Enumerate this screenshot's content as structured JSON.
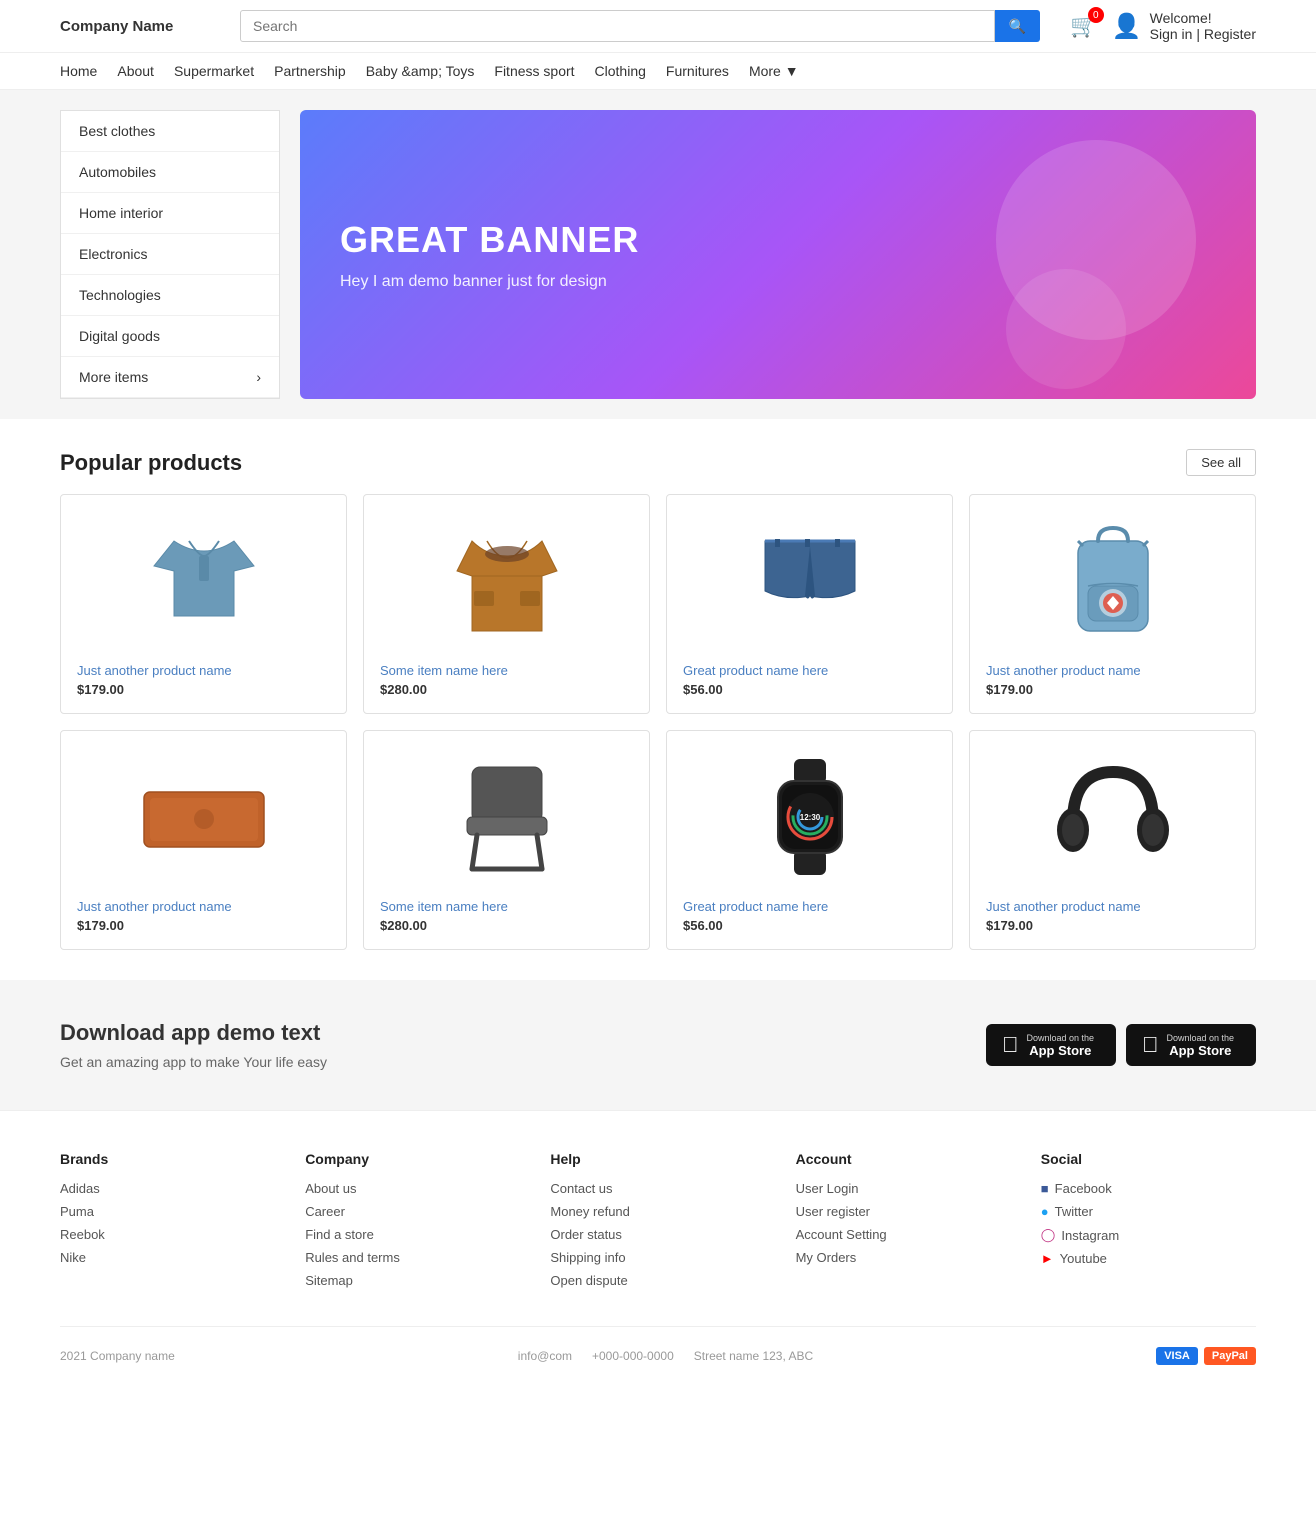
{
  "header": {
    "logo": "Company Name",
    "search_placeholder": "Search",
    "search_button_icon": "search-icon",
    "cart_count": "0",
    "welcome_text": "Welcome!",
    "signin_text": "Sign in | Register"
  },
  "nav": {
    "items": [
      {
        "label": "Home",
        "href": "#"
      },
      {
        "label": "About",
        "href": "#"
      },
      {
        "label": "Supermarket",
        "href": "#"
      },
      {
        "label": "Partnership",
        "href": "#"
      },
      {
        "label": "Baby &amp; Toys",
        "href": "#"
      },
      {
        "label": "Fitness sport",
        "href": "#"
      },
      {
        "label": "Clothing",
        "href": "#"
      },
      {
        "label": "Furnitures",
        "href": "#"
      },
      {
        "label": "More",
        "href": "#"
      }
    ]
  },
  "sidebar": {
    "categories": [
      {
        "label": "Best clothes"
      },
      {
        "label": "Automobiles"
      },
      {
        "label": "Home interior"
      },
      {
        "label": "Electronics"
      },
      {
        "label": "Technologies"
      },
      {
        "label": "Digital goods"
      },
      {
        "label": "More items",
        "has_arrow": true
      }
    ]
  },
  "banner": {
    "title": "GREAT BANNER",
    "subtitle": "Hey I am demo banner just for design"
  },
  "popular": {
    "title": "Popular products",
    "see_all": "See all",
    "products": [
      {
        "name": "Just another product name",
        "price": "$179.00",
        "type": "polo"
      },
      {
        "name": "Some item name here",
        "price": "$280.00",
        "type": "jacket"
      },
      {
        "name": "Great product name here",
        "price": "$56.00",
        "type": "shorts"
      },
      {
        "name": "Just another product name",
        "price": "$179.00",
        "type": "backpack"
      },
      {
        "name": "Just another product name",
        "price": "$179.00",
        "type": "laptop"
      },
      {
        "name": "Some item name here",
        "price": "$280.00",
        "type": "chair"
      },
      {
        "name": "Great product name here",
        "price": "$56.00",
        "type": "watch"
      },
      {
        "name": "Just another product name",
        "price": "$179.00",
        "type": "headphones"
      }
    ]
  },
  "download": {
    "title": "Download app demo text",
    "subtitle": "Get an amazing app to make Your life easy",
    "btn1_sub": "Download on the",
    "btn1_main": "App Store",
    "btn2_sub": "Download on the",
    "btn2_main": "App Store"
  },
  "footer": {
    "brands": {
      "title": "Brands",
      "links": [
        "Adidas",
        "Puma",
        "Reebok",
        "Nike"
      ]
    },
    "company": {
      "title": "Company",
      "links": [
        "About us",
        "Career",
        "Find a store",
        "Rules and terms",
        "Sitemap"
      ]
    },
    "help": {
      "title": "Help",
      "links": [
        "Contact us",
        "Money refund",
        "Order status",
        "Shipping info",
        "Open dispute"
      ]
    },
    "account": {
      "title": "Account",
      "links": [
        "User Login",
        "User register",
        "Account Setting",
        "My Orders"
      ]
    },
    "social": {
      "title": "Social",
      "links": [
        {
          "label": "Facebook",
          "icon": "facebook-icon"
        },
        {
          "label": "Twitter",
          "icon": "twitter-icon"
        },
        {
          "label": "Instagram",
          "icon": "instagram-icon"
        },
        {
          "label": "Youtube",
          "icon": "youtube-icon"
        }
      ]
    },
    "bottom": {
      "copyright": "2021 Company name",
      "email": "info@com",
      "phone": "+000-000-0000",
      "address": "Street name 123, ABC"
    }
  }
}
